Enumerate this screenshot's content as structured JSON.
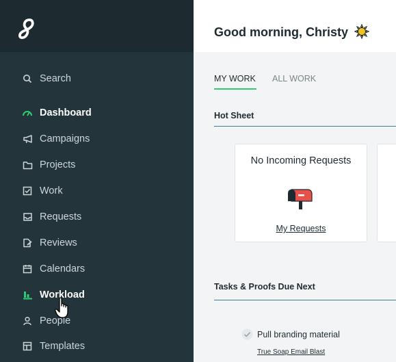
{
  "sidebar": {
    "items": [
      {
        "label": "Search",
        "icon": "search-icon"
      },
      {
        "label": "Dashboard",
        "icon": "dashboard-gauge-icon"
      },
      {
        "label": "Campaigns",
        "icon": "megaphone-icon"
      },
      {
        "label": "Projects",
        "icon": "folder-icon"
      },
      {
        "label": "Work",
        "icon": "checkbox-icon"
      },
      {
        "label": "Requests",
        "icon": "inbox-icon"
      },
      {
        "label": "Reviews",
        "icon": "review-file-icon"
      },
      {
        "label": "Calendars",
        "icon": "calendar-icon"
      },
      {
        "label": "Workload",
        "icon": "bar-chart-icon"
      },
      {
        "label": "People",
        "icon": "person-icon"
      },
      {
        "label": "Templates",
        "icon": "template-grid-icon"
      }
    ]
  },
  "header": {
    "greeting": "Good morning, Christy"
  },
  "tabs": [
    {
      "label": "MY WORK",
      "active": true
    },
    {
      "label": "ALL WORK",
      "active": false
    }
  ],
  "hot_sheet": {
    "title": "Hot Sheet",
    "cards": [
      {
        "title": "No Incoming Requests",
        "link": "My Requests",
        "icon": "mailbox-icon"
      }
    ]
  },
  "tasks": {
    "title": "Tasks & Proofs Due Next",
    "items": [
      {
        "label": "Pull branding material",
        "project": "True Soap Email Blast"
      }
    ]
  },
  "colors": {
    "sidebar_bg": "#23353b",
    "sidebar_top": "#1d2b30",
    "accent_green": "#2ecc71",
    "section_rule": "#3f7a96",
    "main_bg": "#f2f4f5"
  }
}
